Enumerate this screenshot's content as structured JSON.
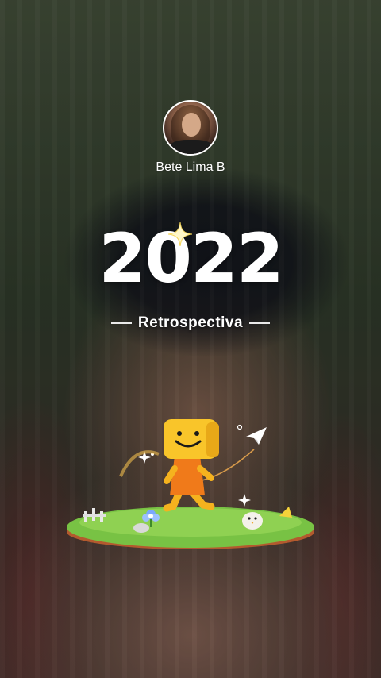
{
  "profile": {
    "username": "Bete Lima B",
    "avatar_icon": "profile-avatar"
  },
  "title": {
    "year": "2022",
    "subtitle": "Retrospectiva"
  },
  "decor": {
    "sparkle_icon": "sparkle-icon",
    "mascot_icon": "smiley-box-mascot",
    "plane_icon": "paper-plane-icon",
    "bird_icon": "chick-icon",
    "flower_icon": "flower-icon",
    "island_icon": "grass-island"
  },
  "colors": {
    "text": "#ffffff",
    "mascot_head": "#f5b21e",
    "mascot_body": "#f07a1a",
    "grass": "#6fb83a"
  }
}
